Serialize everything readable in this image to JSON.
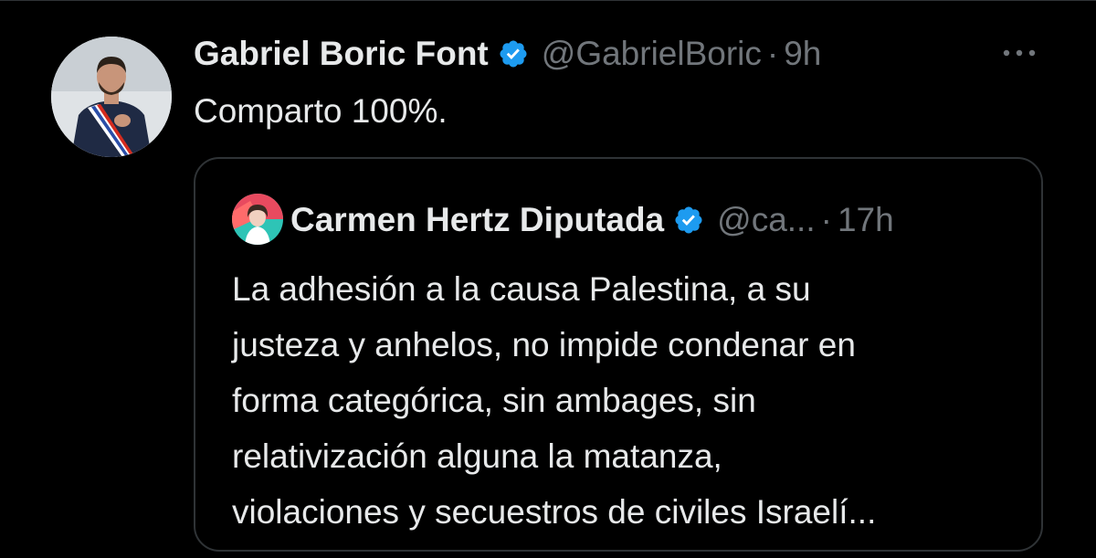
{
  "colors": {
    "background": "#000000",
    "primary_text": "#e7e9ea",
    "secondary_text": "#71767b",
    "border": "#2f3336",
    "verified_blue": "#1d9bf0"
  },
  "tweet": {
    "author_name": "Gabriel Boric Font",
    "handle": "@GabrielBoric",
    "separator": "·",
    "time": "9h",
    "text": "Comparto 100%.",
    "more_icon": "more-horizontal-icon",
    "verified_icon": "verified-badge-icon"
  },
  "quote": {
    "author_name": "Carmen Hertz Diputada",
    "handle": "@ca...",
    "separator": "·",
    "time": "17h",
    "verified_icon": "verified-badge-icon",
    "lines": [
      "La adhesión a la causa Palestina, a su",
      "justeza y anhelos, no impide condenar en",
      "forma categórica, sin ambages, sin",
      "relativización alguna la matanza,",
      "violaciones y secuestros de civiles Israelí..."
    ]
  }
}
